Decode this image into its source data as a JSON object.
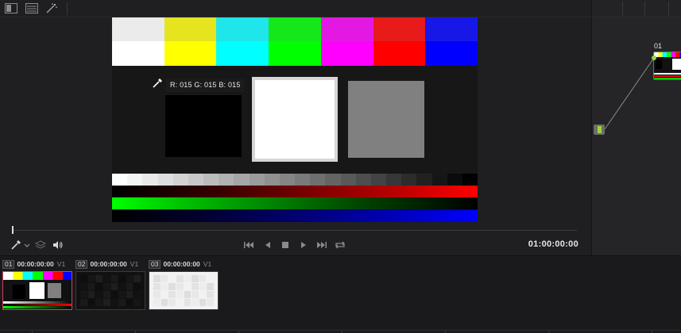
{
  "toolbar": {
    "icons": [
      "single-viewer-icon",
      "split-screen-icon",
      "magic-wand-icon"
    ]
  },
  "viewer": {
    "color_bars_top": [
      "#ebebeb",
      "#e6e31f",
      "#1ee6ea",
      "#15e81a",
      "#e319e3",
      "#e81a1a",
      "#1717e8"
    ],
    "color_bars_bottom": [
      "#ffffff",
      "#ffff00",
      "#00ffff",
      "#00ff00",
      "#ff00ff",
      "#ff0000",
      "#0000ff"
    ],
    "picker_readout": "R: 015 G: 015 B: 015"
  },
  "transport": {
    "left_icons": [
      "eyedropper-icon",
      "chevron-down-icon",
      "layers-icon",
      "volume-icon"
    ],
    "controls": [
      "go-to-start-icon",
      "step-back-icon",
      "stop-icon",
      "play-icon",
      "go-to-end-icon",
      "loop-icon"
    ],
    "timecode": "01:00:00:00"
  },
  "nodes": {
    "node_label": "01"
  },
  "clips": [
    {
      "number": "01",
      "timecode": "00:00:00:00",
      "track": "V1",
      "active": true
    },
    {
      "number": "02",
      "timecode": "00:00:00:00",
      "track": "V1",
      "active": false
    },
    {
      "number": "03",
      "timecode": "00:00:00:00",
      "track": "V1",
      "active": false
    }
  ],
  "colors": {
    "accent_node": "#9ad43b",
    "active_clip_border": "#d04060"
  }
}
